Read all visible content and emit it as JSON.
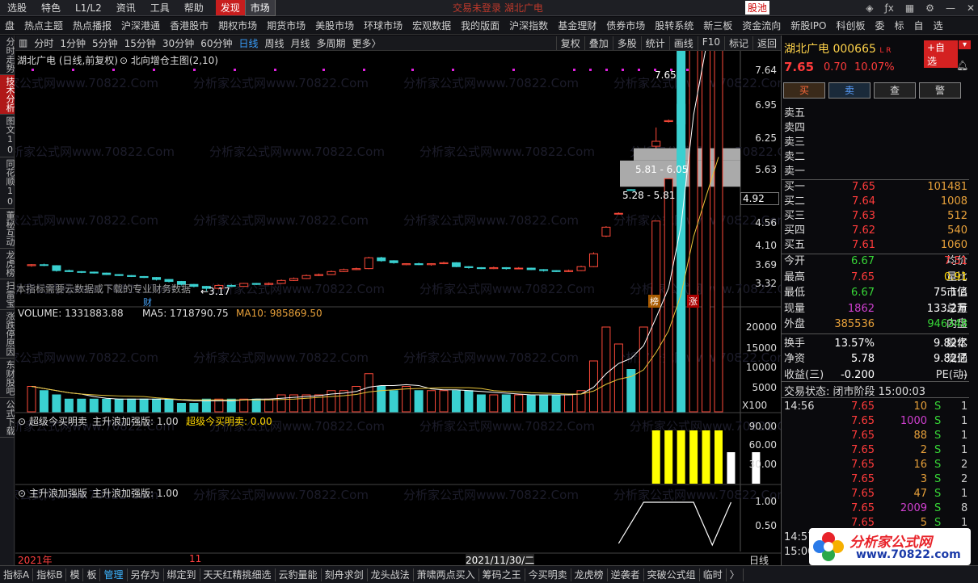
{
  "topbar": {
    "items": [
      "选股",
      "特色",
      "L1/L2",
      "资讯",
      "工具",
      "帮助"
    ],
    "btn_discover": "发现",
    "btn_market": "市场",
    "center_title": "交易未登录  湖北广电",
    "stock_pool": "股池",
    "icons": [
      "layers-icon",
      "formula-icon",
      "grid-icon",
      "gear-icon",
      "minimize-icon",
      "close-icon"
    ]
  },
  "navbar": [
    "盘",
    "热点主题",
    "热点播报",
    "沪深港通",
    "香港股市",
    "期权市场",
    "期货市场",
    "美股市场",
    "环球市场",
    "宏观数据",
    "我的版面",
    "沪深指数",
    "基金理财",
    "债券市场",
    "股转系统",
    "新三板",
    "资金流向",
    "新股IPO",
    "科创板",
    "委",
    "标",
    "自",
    "选"
  ],
  "leftbar": [
    {
      "label": "分时走势",
      "active": false
    },
    {
      "label": "技术分析",
      "active": true
    },
    {
      "label": "图文10",
      "active": false
    },
    {
      "label": "同花顺10",
      "active": false
    },
    {
      "label": "董秘互动",
      "active": false
    },
    {
      "label": "龙虎榜",
      "active": false
    },
    {
      "label": "扫雷宝",
      "active": false
    },
    {
      "label": "涨跌停原因",
      "active": false
    },
    {
      "label": "东财股吧",
      "active": false
    },
    {
      "label": "公式下载",
      "active": false
    }
  ],
  "periodbar": {
    "items": [
      "分时",
      "1分钟",
      "5分钟",
      "15分钟",
      "30分钟",
      "60分钟",
      "日线",
      "周线",
      "月线",
      "多周期",
      "更多〉"
    ],
    "active": "日线",
    "right": [
      "复权",
      "叠加",
      "多股",
      "统计",
      "画线",
      "F10",
      "标记",
      "返回"
    ]
  },
  "kchart": {
    "title": "湖北广电 (日线,前复权)",
    "indicator": "北向增仓主图(2,10)",
    "yaxis": [
      "7.64",
      "6.95",
      "6.25",
      "5.63",
      "4.92",
      "4.56",
      "4.10",
      "3.69",
      "3.32"
    ],
    "current_price_tag": "4.92",
    "high_label": "7.65",
    "low_label": "←3.17",
    "zone1": "5.81 - 6.05",
    "zone2": "5.28 - 5.81",
    "notice": "本指标需要云数据或下载的专业财务数据",
    "marker_cai": "财",
    "marker_bang": "榜",
    "marker_zhang": "涨"
  },
  "volume": {
    "label": "VOLUME: 1331883.88",
    "ma5": "MA5: 1718790.75",
    "ma10": "MA10: 985869.50",
    "yaxis": [
      "20000",
      "15000",
      "10000",
      "5000"
    ],
    "unit": "X100"
  },
  "ind1": {
    "label": "超级今买明卖",
    "part2": "主升浪加强版: 1.00",
    "part3": "超级今买明卖: 0.00",
    "yaxis": [
      "90.00",
      "60.00",
      "30.00"
    ]
  },
  "ind2": {
    "label": "主升浪加强版",
    "part2": "主升浪加强版: 1.00",
    "yaxis": [
      "1.00",
      "0.50"
    ]
  },
  "xaxis": {
    "start": "2021年",
    "mid": "11",
    "date": "2021/11/30/二",
    "period": "日线"
  },
  "quote": {
    "name": "湖北广电",
    "code": "000665",
    "badge": "L R",
    "add_button": "+自选",
    "price": "7.65",
    "change": "0.70",
    "pct": "10.07%",
    "buttons": [
      "买",
      "卖",
      "查",
      "警"
    ],
    "asks": [
      {
        "label": "卖五",
        "price": "",
        "vol": ""
      },
      {
        "label": "卖四",
        "price": "",
        "vol": ""
      },
      {
        "label": "卖三",
        "price": "",
        "vol": ""
      },
      {
        "label": "卖二",
        "price": "",
        "vol": ""
      },
      {
        "label": "卖一",
        "price": "",
        "vol": ""
      }
    ],
    "bids": [
      {
        "label": "买一",
        "price": "7.65",
        "vol": "101481"
      },
      {
        "label": "买二",
        "price": "7.64",
        "vol": "1008"
      },
      {
        "label": "买三",
        "price": "7.63",
        "vol": "512"
      },
      {
        "label": "买四",
        "price": "7.62",
        "vol": "540"
      },
      {
        "label": "买五",
        "price": "7.61",
        "vol": "1060"
      }
    ],
    "stats": [
      {
        "l1": "今开",
        "v1": "6.67",
        "c1": "grn",
        "l2": "均价",
        "v2": "7.51",
        "c2": "red"
      },
      {
        "l1": "最高",
        "v1": "7.65",
        "c1": "red",
        "l2": "量比",
        "v2": "0.91",
        "c2": "yel"
      },
      {
        "l1": "最低",
        "v1": "6.67",
        "c1": "grn",
        "l2": "市值",
        "v2": "75.1亿",
        "c2": "wht"
      },
      {
        "l1": "现量",
        "v1": "1862",
        "c1": "mag",
        "l2": "总量",
        "v2": "133.2万",
        "c2": "wht"
      },
      {
        "l1": "外盘",
        "v1": "385536",
        "c1": "org",
        "l2": "内盘",
        "v2": "946348",
        "c2": "grn"
      },
      {
        "l1": "换手",
        "v1": "13.57%",
        "c1": "wht",
        "l2": "股本",
        "v2": "9.82亿",
        "c2": "wht"
      },
      {
        "l1": "净资",
        "v1": "5.78",
        "c1": "wht",
        "l2": "流通",
        "v2": "9.82亿",
        "c2": "wht"
      },
      {
        "l1": "收益(三)",
        "v1": "-0.200",
        "c1": "wht",
        "l2": "PE(动)",
        "v2": "--",
        "c2": "wht"
      }
    ],
    "trade_status": "交易状态: 闭市阶段 15:00:03",
    "ticks": [
      {
        "t": "14:56",
        "p": "7.65",
        "v": "10",
        "vc": "org",
        "s": "S",
        "n": "1"
      },
      {
        "t": "",
        "p": "7.65",
        "v": "1000",
        "vc": "mag",
        "s": "S",
        "n": "1"
      },
      {
        "t": "",
        "p": "7.65",
        "v": "88",
        "vc": "org",
        "s": "S",
        "n": "1"
      },
      {
        "t": "",
        "p": "7.65",
        "v": "2",
        "vc": "org",
        "s": "S",
        "n": "1"
      },
      {
        "t": "",
        "p": "7.65",
        "v": "16",
        "vc": "org",
        "s": "S",
        "n": "2"
      },
      {
        "t": "",
        "p": "7.65",
        "v": "3",
        "vc": "org",
        "s": "S",
        "n": "2"
      },
      {
        "t": "",
        "p": "7.65",
        "v": "47",
        "vc": "org",
        "s": "S",
        "n": "1"
      },
      {
        "t": "",
        "p": "7.65",
        "v": "2009",
        "vc": "mag",
        "s": "S",
        "n": "8"
      },
      {
        "t": "",
        "p": "7.65",
        "v": "5",
        "vc": "org",
        "s": "S",
        "n": "1"
      },
      {
        "t": "14:57",
        "p": "",
        "v": "",
        "vc": "org",
        "s": "",
        "n": ""
      },
      {
        "t": "15:00",
        "p": "",
        "v": "",
        "vc": "org",
        "s": "",
        "n": ""
      }
    ],
    "logo_text": "分析家公式网",
    "logo_url": "www.70822.com"
  },
  "bottombar": [
    "指标A",
    "指标B",
    "模",
    "板",
    "管理",
    "另存为",
    "绑定到",
    "天天红精挑细选",
    "云豹量能",
    "刻舟求剑",
    "龙头战法",
    "萧啸两点买入",
    "筹码之王",
    "今买明卖",
    "龙虎榜",
    "逆袭者",
    "突破公式组",
    "临时",
    "〉"
  ],
  "bottom_active": "管理",
  "watermark": "分析家公式网www.70822.Com"
}
